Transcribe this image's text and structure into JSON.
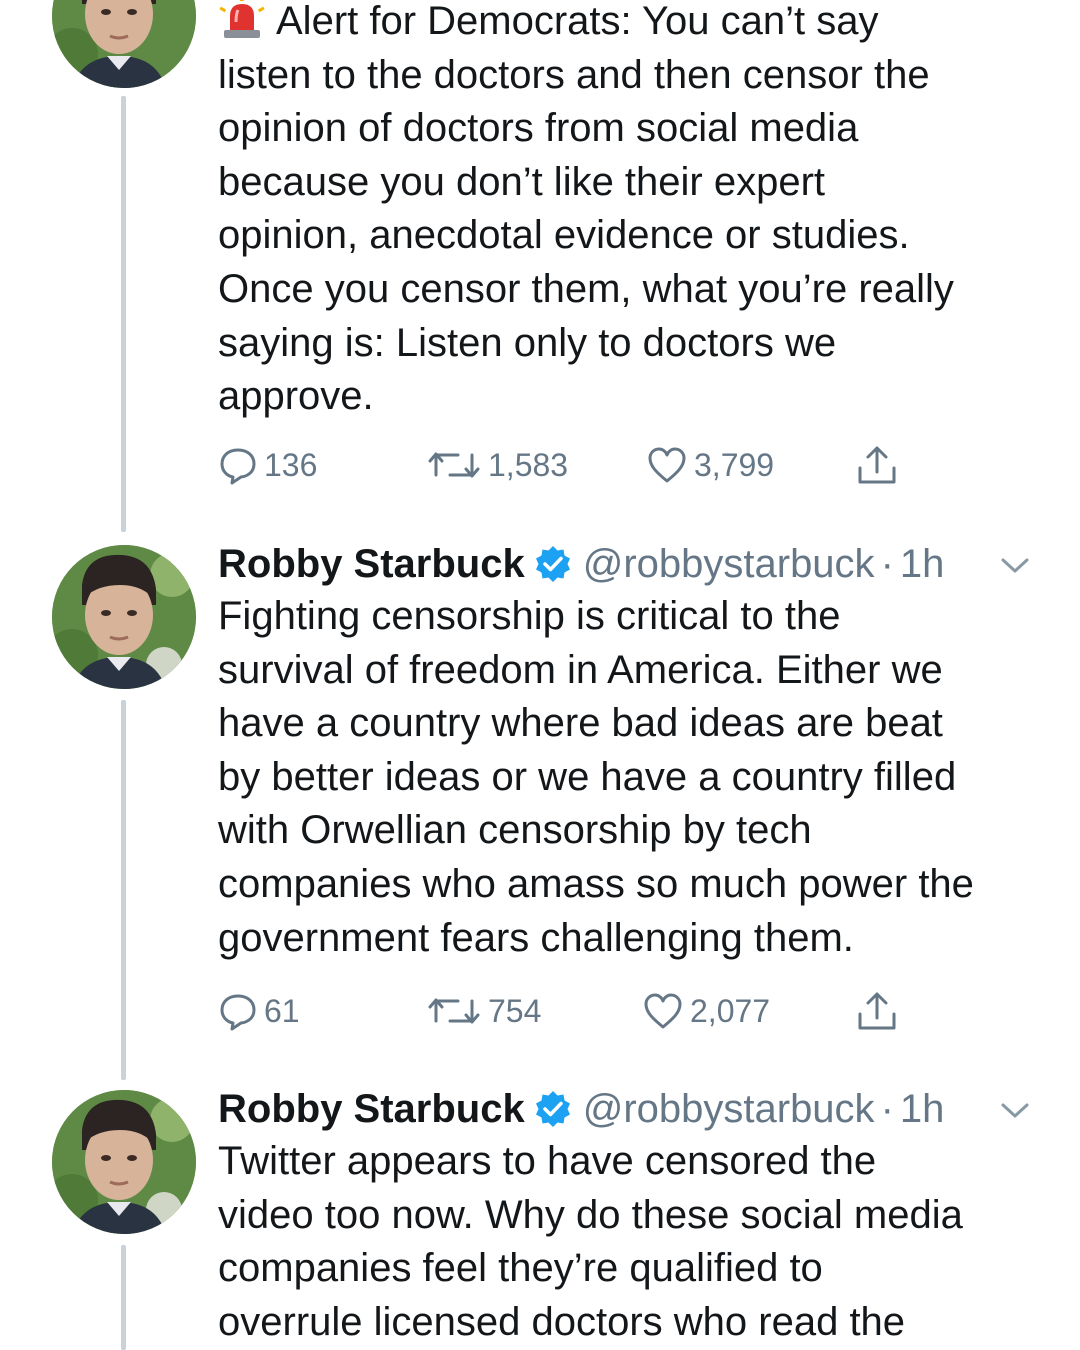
{
  "tweets": [
    {
      "alert_emoji": "🚨",
      "text": "Alert for Democrats: You can’t say\nlisten to the doctors and then censor the\nopinion of doctors from social media\nbecause you don’t like their expert\nopinion, anecdotal evidence or studies.\nOnce you censor them, what you’re really\nsaying is: Listen only to doctors we\napprove.",
      "replies": "136",
      "retweets": "1,583",
      "likes": "3,799"
    },
    {
      "name": "Robby Starbuck",
      "handle": "@robbystarbuck",
      "separator": "·",
      "time": "1h",
      "text": "Fighting censorship is critical to the\nsurvival of freedom in America. Either we\nhave a country where bad ideas are beat\nby better ideas or we have a country filled\nwith Orwellian censorship by tech\ncompanies who amass so much power the\ngovernment fears challenging them.",
      "replies": "61",
      "retweets": "754",
      "likes": "2,077"
    },
    {
      "name": "Robby Starbuck",
      "handle": "@robbystarbuck",
      "separator": "·",
      "time": "1h",
      "text": "Twitter appears to have censored the\nvideo too now. Why do these social media\ncompanies feel they’re qualified to\noverrule licensed doctors who read the"
    }
  ],
  "colors": {
    "text": "#14171a",
    "secondary": "#657786",
    "verified": "#1da1f2",
    "thread_line": "#c9d1d9"
  },
  "icons": [
    "reply-icon",
    "retweet-icon",
    "like-icon",
    "share-icon",
    "verified-badge-icon",
    "chevron-down-icon",
    "police-light-emoji"
  ]
}
